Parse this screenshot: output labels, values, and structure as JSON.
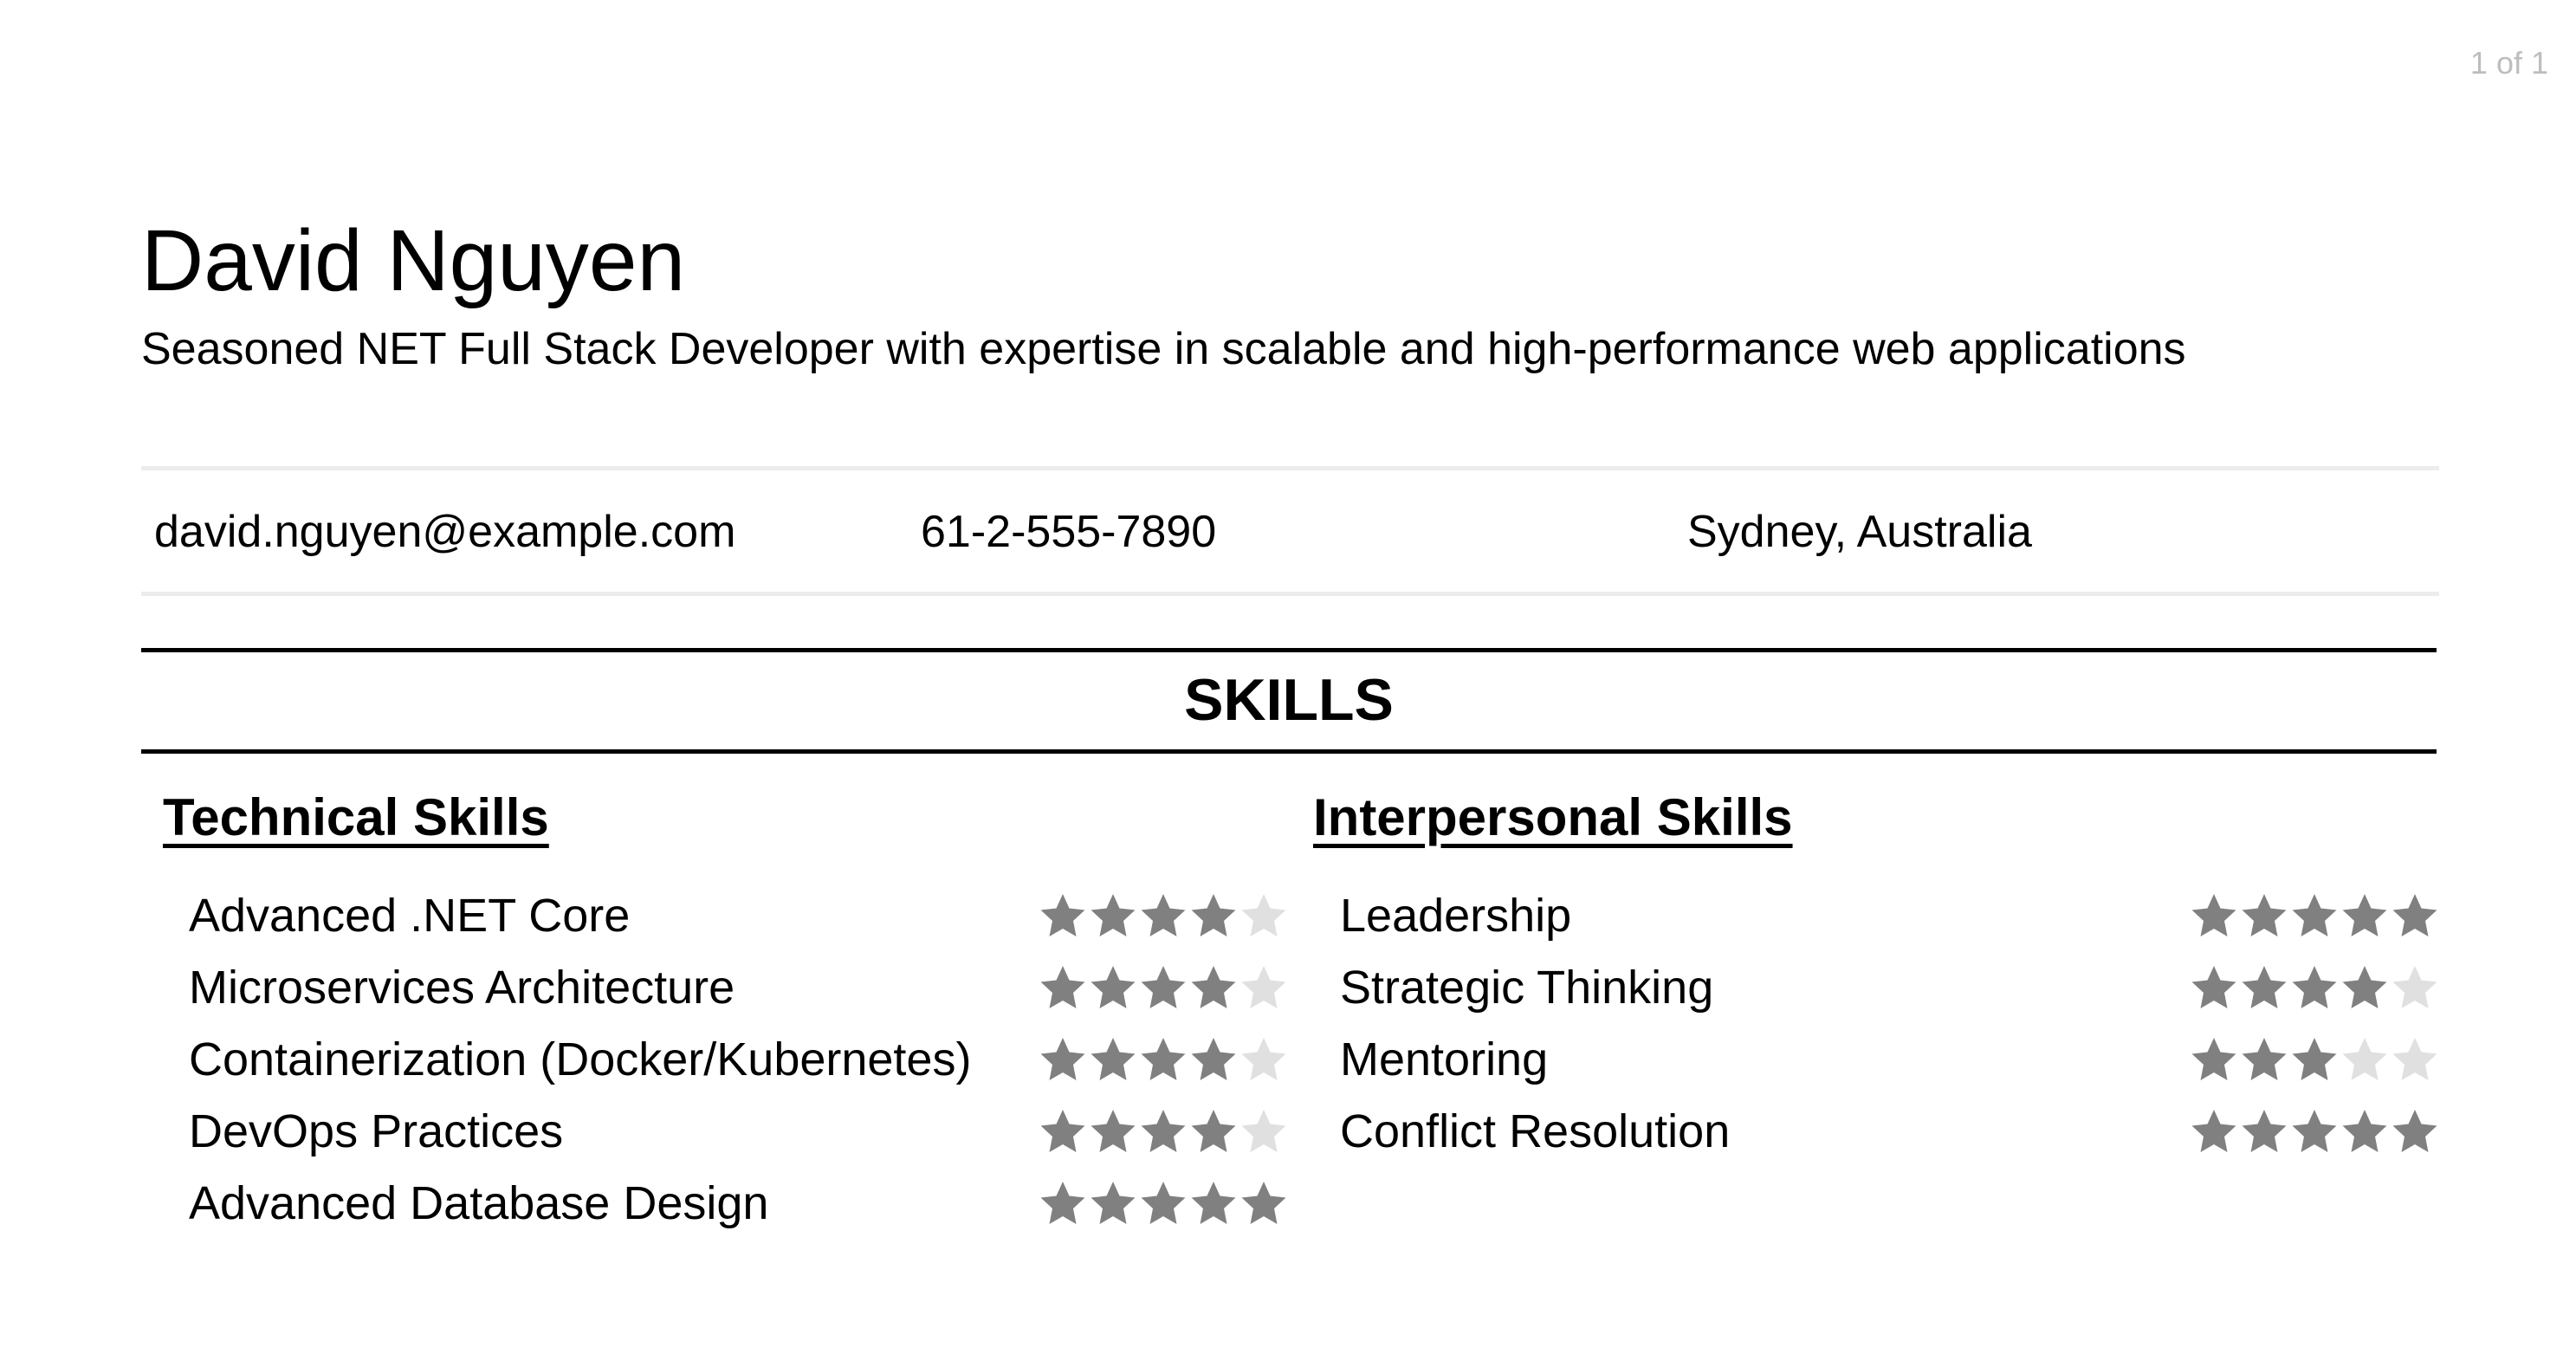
{
  "page_counter": "1 of 1",
  "header": {
    "name": "David Nguyen",
    "tagline": "Seasoned NET Full Stack Developer with expertise in scalable and high-performance web applications"
  },
  "contact": {
    "email": "david.nguyen@example.com",
    "phone": "61-2-555-7890",
    "location": "Sydney, Australia"
  },
  "skills": {
    "title": "SKILLS",
    "max_rating": 5,
    "colors": {
      "filled_star": "#808080",
      "empty_star": "#e0e0e0"
    },
    "technical": {
      "heading": "Technical Skills",
      "items": [
        {
          "name": "Advanced .NET Core",
          "rating": 4
        },
        {
          "name": "Microservices Architecture",
          "rating": 4
        },
        {
          "name": "Containerization (Docker/Kubernetes)",
          "rating": 4
        },
        {
          "name": "DevOps Practices",
          "rating": 4
        },
        {
          "name": "Advanced Database Design",
          "rating": 5
        }
      ]
    },
    "interpersonal": {
      "heading": "Interpersonal Skills",
      "items": [
        {
          "name": "Leadership",
          "rating": 5
        },
        {
          "name": "Strategic Thinking",
          "rating": 4
        },
        {
          "name": "Mentoring",
          "rating": 3
        },
        {
          "name": "Conflict Resolution",
          "rating": 5
        }
      ]
    }
  }
}
